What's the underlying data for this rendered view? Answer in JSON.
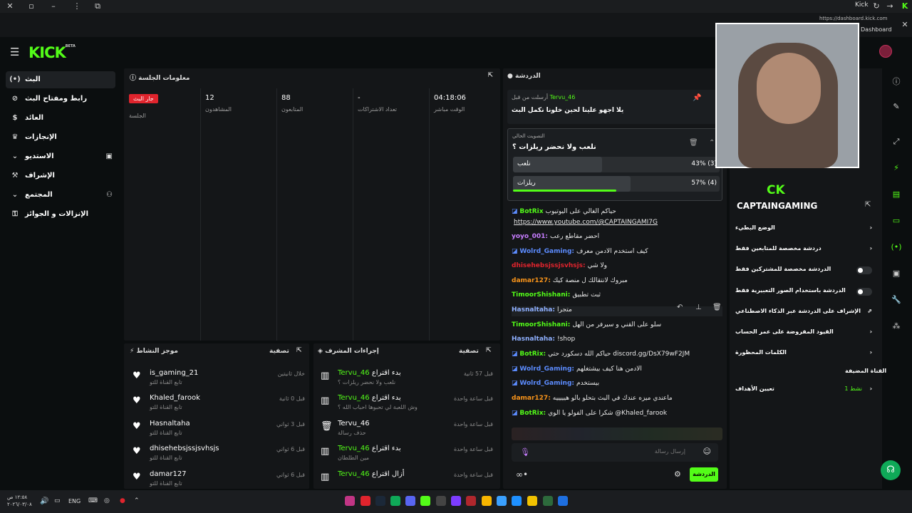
{
  "browser": {
    "site_label": "Kick",
    "url": "https://dashboard.kick.com",
    "dashboard_label": "Dashboard"
  },
  "brand": {
    "logo_text": "KICK",
    "logo_sup": "BETA",
    "accent": "#53fc18"
  },
  "sidebar": {
    "items": [
      {
        "label": "البث",
        "icon": "broadcast-icon",
        "active": true
      },
      {
        "label": "رابط ومفتاح البث",
        "icon": "link-icon"
      },
      {
        "label": "العائد",
        "icon": "coins-icon"
      },
      {
        "label": "الإنجازات",
        "icon": "trophy-icon"
      },
      {
        "label": "الاستديو",
        "icon": "studio-icon",
        "has_chevron": true
      },
      {
        "label": "الإشراف",
        "icon": "gavel-icon"
      },
      {
        "label": "المجتمع",
        "icon": "community-icon",
        "has_chevron": true
      },
      {
        "label": "الإنزالات و الجوائز",
        "icon": "drops-icon"
      }
    ]
  },
  "session": {
    "title": "معلومات الجلسة",
    "live_badge": "جار البث",
    "live_sub": "الجلسة",
    "stats": [
      {
        "value": "12",
        "label": "المشاهدون"
      },
      {
        "value": "88",
        "label": "المتابعون"
      },
      {
        "value": "-",
        "label": "تعداد الاشتراكات"
      },
      {
        "value": "04:18:06",
        "label": "الوقت مباشر"
      }
    ]
  },
  "activity": {
    "title": "موجز النشاط",
    "filter": "تصفية",
    "rows": [
      {
        "name": "is_gaming_21",
        "sub": "تابع القناة للتو",
        "time": "خلال ثانيتين"
      },
      {
        "name": "Khaled_farook",
        "sub": "تابع القناة للتو",
        "time": "قبل 0 ثانية"
      },
      {
        "name": "Hasnaltaha",
        "sub": "تابع القناة للتو",
        "time": "قبل 3 ثواني"
      },
      {
        "name": "dhisehebsjssjsvhsjs",
        "sub": "تابع القناة للتو",
        "time": "قبل 6 ثواني"
      },
      {
        "name": "damar127",
        "sub": "تابع القناة للتو",
        "time": "قبل 6 ثواني"
      }
    ]
  },
  "modactions": {
    "title": "إجراءات المشرف",
    "filter": "تصفية",
    "rows": [
      {
        "name": "Tervu_46",
        "action": "بدء اقتراع",
        "sub": "نلعب ولا نحضر ريلزات ؟",
        "time": "قبل 57 ثانية"
      },
      {
        "name": "Tervu_46",
        "action": "بدء اقتراع",
        "sub": "وش اللعبة لي تحبوها احباب الله ؟",
        "time": "قبل ساعة واحدة"
      },
      {
        "name": "Tervu_46",
        "action": "",
        "sub": "حذف رسالة",
        "time": "قبل ساعة واحدة"
      },
      {
        "name": "Tervu_46",
        "action": "بدء اقتراع",
        "sub": "مين الطلطان",
        "time": "قبل ساعة واحدة"
      },
      {
        "name": "Tervu_46",
        "action": "أزال اقتراع",
        "sub": "",
        "time": "قبل ساعة واحدة"
      }
    ]
  },
  "chat": {
    "title": "الدردشة",
    "pinned": {
      "author": "Tervu_46",
      "pre": "أرسلت من قبل",
      "text": "يلا اجهو علينا لحين خلونا نكمل البث"
    },
    "poll": {
      "header": "التصويت الحالي",
      "question": "نلعب ولا نحضر ريلزات ؟",
      "options": [
        {
          "label": "نلعب",
          "pct_text": "43% (3)",
          "fraction": 0.43
        },
        {
          "label": "ريلزات",
          "pct_text": "57% (4)",
          "fraction": 0.57
        }
      ]
    },
    "messages": [
      {
        "user": "BotRix",
        "color": "#53fc18",
        "text": "حياكم الغالي على اليوتيوب"
      },
      {
        "user": "",
        "color": "#fff",
        "text": "https://www.youtube.com/@CAPTAINGAMI7G"
      },
      {
        "user": "yoyo_001:",
        "color": "#c77dff",
        "text": "احضر مقاطع رعب"
      },
      {
        "user": "Wolrd_Gaming:",
        "color": "#5c8cff",
        "text": "كيف استخدم الادمن معرف"
      },
      {
        "user": "dhisehebsjssjsvhsjs:",
        "color": "#e0242d",
        "text": "ولا شي"
      },
      {
        "user": "damar127:",
        "color": "#f7931a",
        "text": "مبروك لانتقالك ل منصة كيك"
      },
      {
        "user": "TimoorShishani:",
        "color": "#53fc18",
        "text": "ثبت تطبيق"
      },
      {
        "user": "Hasnaltaha:",
        "color": "#8fb0ff",
        "text": "متجرا"
      },
      {
        "user": "TimoorShishani:",
        "color": "#53fc18",
        "text": "سلو على القني و سيرفر من الهل"
      },
      {
        "user": "Hasnaltaha:",
        "color": "#8fb0ff",
        "text": "!shop"
      },
      {
        "user": "BotRix:",
        "color": "#53fc18",
        "text": "حياكم الله دسكورد حتي discord.gg/DsX79wF2JM"
      },
      {
        "user": "Wolrd_Gaming:",
        "color": "#5c8cff",
        "text": "الادمن هنا كيف بيشتغلهم"
      },
      {
        "user": "Wolrd_Gaming:",
        "color": "#5c8cff",
        "text": "بيستخدم"
      },
      {
        "user": "damar127:",
        "color": "#f7931a",
        "text": "ماعندي ميزه عندك في البث بتحلو بالو هيييييه"
      },
      {
        "user": "BotRix:",
        "color": "#53fc18",
        "text": "شكرا على الفولو يا الوي @Khaled_farook"
      }
    ],
    "input_placeholder": "إرسال رسالة",
    "send_label": "الدردشة"
  },
  "settings": {
    "overlay_text": "CAPTAINGAMING",
    "items": [
      {
        "label": "الوضع البطيء",
        "control": "chevron"
      },
      {
        "label": "دردشة مخصصة للمتابعين فقط",
        "control": "chevron"
      },
      {
        "label": "الدردشة مخصصة للمشتركين فقط",
        "control": "toggle"
      },
      {
        "label": "الدردشة باستخدام الصور التعبيرية فقط",
        "control": "toggle"
      },
      {
        "label": "الإشراف على الدردشة عبر الذكاء الاصطناعي",
        "control": "external"
      },
      {
        "label": "القيود المفروضة على عمر الحساب",
        "control": "chevron"
      },
      {
        "label": "الكلمات المحظورة",
        "control": "chevron"
      }
    ],
    "target_section": "القناة المضيفة",
    "target_label": "تعيين الأهداف",
    "target_value": "1 نشط"
  },
  "taskbar": {
    "time": "١٢:٥٨ ص",
    "date": "٢٠٢٦/٠٣/٠٨",
    "lang": "ENG"
  }
}
